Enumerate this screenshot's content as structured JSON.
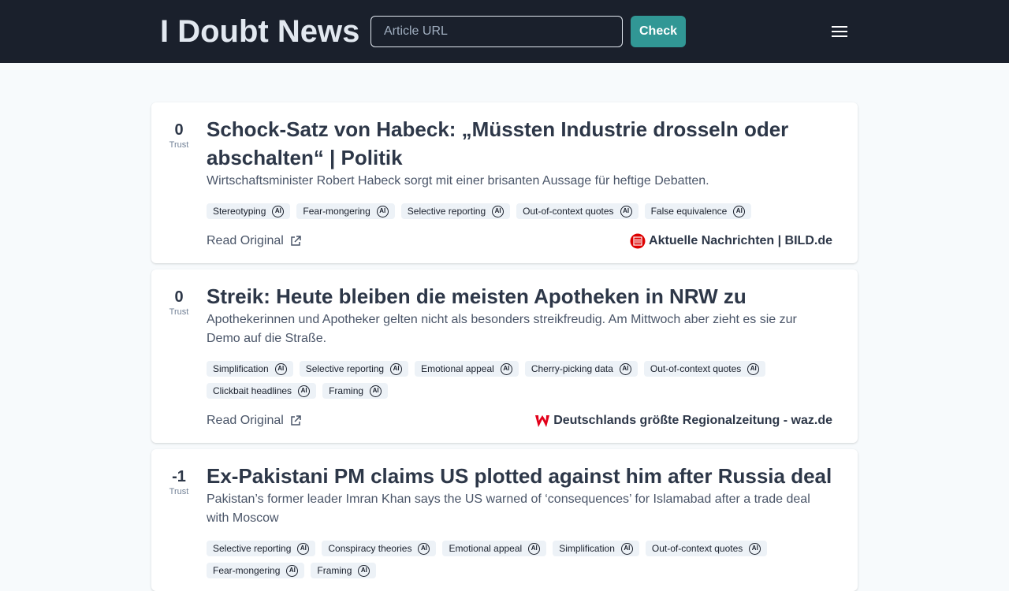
{
  "header": {
    "logo": "I Doubt News",
    "url_placeholder": "Article URL",
    "check_label": "Check"
  },
  "trust_label": "Trust",
  "read_original_label": "Read Original",
  "ai_label": "AI",
  "articles": [
    {
      "trust": "0",
      "title": "Schock-Satz von Habeck: „Müssten Industrie drosseln oder abschalten“ | Politik",
      "description": "Wirtschaftsminister Robert Habeck sorgt mit einer brisanten Aussage für heftige Debatten.",
      "tags": [
        "Stereotyping",
        "Fear-mongering",
        "Selective reporting",
        "Out-of-context quotes",
        "False equivalence"
      ],
      "source": "Aktuelle Nachrichten | BILD.de",
      "source_icon": "bild-logo-icon"
    },
    {
      "trust": "0",
      "title": "Streik: Heute bleiben die meisten Apotheken in NRW zu",
      "description": "Apothekerinnen und Apotheker gelten nicht als besonders streikfreudig. Am Mittwoch aber zieht es sie zur Demo auf die Straße.",
      "tags": [
        "Simplification",
        "Selective reporting",
        "Emotional appeal",
        "Cherry-picking data",
        "Out-of-context quotes",
        "Clickbait headlines",
        "Framing"
      ],
      "source": "Deutschlands größte Regionalzeitung - waz.de",
      "source_icon": "waz-logo-icon"
    },
    {
      "trust": "-1",
      "title": "Ex-Pakistani PM claims US plotted against him after Russia deal",
      "description": "Pakistan’s former leader Imran Khan says the US warned of ‘consequences’ for Islamabad after a trade deal with Moscow",
      "tags": [
        "Selective reporting",
        "Conspiracy theories",
        "Emotional appeal",
        "Simplification",
        "Out-of-context quotes",
        "Fear-mongering",
        "Framing"
      ]
    }
  ],
  "colors": {
    "header_bg": "#1a202c",
    "accent": "#319795",
    "page_bg": "#f7fafc"
  }
}
